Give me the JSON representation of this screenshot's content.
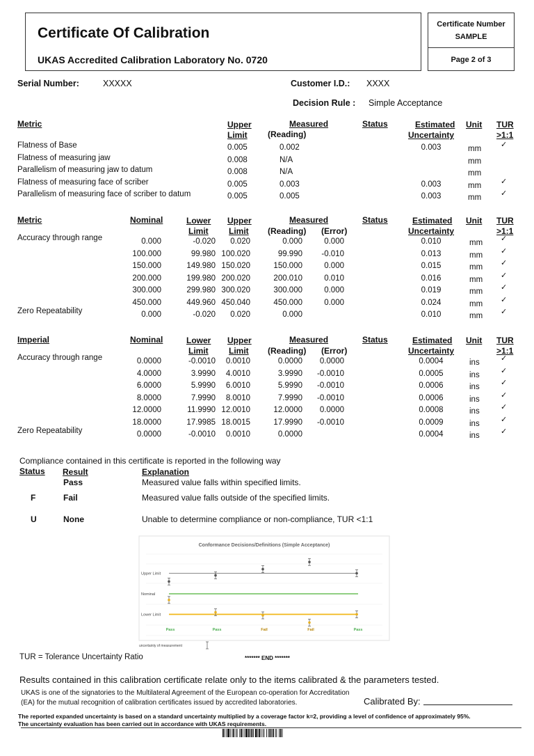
{
  "header": {
    "title": "Certificate Of Calibration",
    "subtitle": "UKAS Accredited Calibration Laboratory No. 0720",
    "cert_number_label": "Certificate Number",
    "cert_number": "SAMPLE",
    "page": "Page 2 of 3"
  },
  "info": {
    "serial_label": "Serial Number:",
    "serial_value": "XXXXX",
    "customer_label": "Customer I.D.:",
    "customer_value": "XXXX",
    "rule_label": "Decision Rule :",
    "rule_value": "Simple Acceptance"
  },
  "table1": {
    "headers": {
      "metric": "Metric",
      "upper1": "Upper",
      "upper2": "Limit",
      "measured": "Measured",
      "reading": "(Reading)",
      "status": "Status",
      "est1": "Estimated",
      "est2": "Uncertainty",
      "unit": "Unit",
      "tur1": "TUR",
      "tur2": ">1:1"
    },
    "rows": [
      {
        "name": "Flatness of Base",
        "upper": "0.005",
        "reading": "0.002",
        "unc": "0.003",
        "unit": "mm",
        "tur": "✓"
      },
      {
        "name": "Flatness of measuring jaw",
        "upper": "0.008",
        "reading": "N/A",
        "unc": "",
        "unit": "mm",
        "tur": ""
      },
      {
        "name": "Parallelism of measuring jaw to datum",
        "upper": "0.008",
        "reading": "N/A",
        "unc": "",
        "unit": "mm",
        "tur": ""
      },
      {
        "name": "Flatness of measuring face of scriber",
        "upper": "0.005",
        "reading": "0.003",
        "unc": "0.003",
        "unit": "mm",
        "tur": "✓"
      },
      {
        "name": "Parallelism of measuring face of scriber to datum",
        "upper": "0.005",
        "reading": "0.005",
        "unc": "0.003",
        "unit": "mm",
        "tur": "✓"
      }
    ]
  },
  "table2": {
    "headers": {
      "metric": "Metric",
      "nominal": "Nominal",
      "lower1": "Lower",
      "lower2": "Limit",
      "upper1": "Upper",
      "upper2": "Limit",
      "measured": "Measured",
      "reading": "(Reading)",
      "error": "(Error)",
      "status": "Status",
      "est1": "Estimated",
      "est2": "Uncertainty",
      "unit": "Unit",
      "tur1": "TUR",
      "tur2": ">1:1"
    },
    "rows": [
      {
        "name": "Accuracy through range",
        "nominal": "0.000",
        "lower": "-0.020",
        "upper": "0.020",
        "reading": "0.000",
        "error": "0.000",
        "unc": "0.010",
        "unit": "mm",
        "tur": "✓"
      },
      {
        "name": "",
        "nominal": "100.000",
        "lower": "99.980",
        "upper": "100.020",
        "reading": "99.990",
        "error": "-0.010",
        "unc": "0.013",
        "unit": "mm",
        "tur": "✓"
      },
      {
        "name": "",
        "nominal": "150.000",
        "lower": "149.980",
        "upper": "150.020",
        "reading": "150.000",
        "error": "0.000",
        "unc": "0.015",
        "unit": "mm",
        "tur": "✓"
      },
      {
        "name": "",
        "nominal": "200.000",
        "lower": "199.980",
        "upper": "200.020",
        "reading": "200.010",
        "error": "0.010",
        "unc": "0.016",
        "unit": "mm",
        "tur": "✓"
      },
      {
        "name": "",
        "nominal": "300.000",
        "lower": "299.980",
        "upper": "300.020",
        "reading": "300.000",
        "error": "0.000",
        "unc": "0.019",
        "unit": "mm",
        "tur": "✓"
      },
      {
        "name": "",
        "nominal": "450.000",
        "lower": "449.960",
        "upper": "450.040",
        "reading": "450.000",
        "error": "0.000",
        "unc": "0.024",
        "unit": "mm",
        "tur": "✓"
      },
      {
        "name": "Zero Repeatability",
        "nominal": "0.000",
        "lower": "-0.020",
        "upper": "0.020",
        "reading": "0.000",
        "error": "",
        "unc": "0.010",
        "unit": "mm",
        "tur": "✓"
      }
    ]
  },
  "table3": {
    "headers": {
      "metric": "Imperial",
      "nominal": "Nominal",
      "lower1": "Lower",
      "lower2": "Limit",
      "upper1": "Upper",
      "upper2": "Limit",
      "measured": "Measured",
      "reading": "(Reading)",
      "error": "(Error)",
      "status": "Status",
      "est1": "Estimated",
      "est2": "Uncertainty",
      "unit": "Unit",
      "tur1": "TUR",
      "tur2": ">1:1"
    },
    "rows": [
      {
        "name": "Accuracy through range",
        "nominal": "0.0000",
        "lower": "-0.0010",
        "upper": "0.0010",
        "reading": "0.0000",
        "error": "0.0000",
        "unc": "0.0004",
        "unit": "ins",
        "tur": "✓"
      },
      {
        "name": "",
        "nominal": "4.0000",
        "lower": "3.9990",
        "upper": "4.0010",
        "reading": "3.9990",
        "error": "-0.0010",
        "unc": "0.0005",
        "unit": "ins",
        "tur": "✓"
      },
      {
        "name": "",
        "nominal": "6.0000",
        "lower": "5.9990",
        "upper": "6.0010",
        "reading": "5.9990",
        "error": "-0.0010",
        "unc": "0.0006",
        "unit": "ins",
        "tur": "✓"
      },
      {
        "name": "",
        "nominal": "8.0000",
        "lower": "7.9990",
        "upper": "8.0010",
        "reading": "7.9990",
        "error": "-0.0010",
        "unc": "0.0006",
        "unit": "ins",
        "tur": "✓"
      },
      {
        "name": "",
        "nominal": "12.0000",
        "lower": "11.9990",
        "upper": "12.0010",
        "reading": "12.0000",
        "error": "0.0000",
        "unc": "0.0008",
        "unit": "ins",
        "tur": "✓"
      },
      {
        "name": "",
        "nominal": "18.0000",
        "lower": "17.9985",
        "upper": "18.0015",
        "reading": "17.9990",
        "error": "-0.0010",
        "unc": "0.0009",
        "unit": "ins",
        "tur": "✓"
      },
      {
        "name": "Zero Repeatability",
        "nominal": "0.0000",
        "lower": "-0.0010",
        "upper": "0.0010",
        "reading": "0.0000",
        "error": "",
        "unc": "0.0004",
        "unit": "ins",
        "tur": "✓"
      }
    ]
  },
  "compliance": {
    "intro": "Compliance contained in this certificate is reported in the following way",
    "headers": {
      "status": "Status",
      "result": "Result",
      "explanation": "Explanation"
    },
    "rows": [
      {
        "status": "",
        "result": "Pass",
        "explanation": "Measured value falls within specified limits."
      },
      {
        "status": "F",
        "result": "Fail",
        "explanation": "Measured value falls outside of the specified limits."
      },
      {
        "status": "U",
        "result": "None",
        "explanation": "Unable to determine compliance or non-compliance, TUR <1:1"
      }
    ]
  },
  "chart_data": {
    "type": "scatter",
    "title": "Conformance Decisions/Definitions (Simple Acceptance)",
    "ylabels": [
      "Upper Limit",
      "Nominal",
      "Lower Limit"
    ],
    "legend": "uncertainty of measurement",
    "colors": {
      "upper": "#8a8a8a",
      "nominal": "#6bbf59",
      "lower": "#f2b619",
      "point_dark": "#555555",
      "point_yellow": "#e8b020",
      "pass": "#4caf50",
      "fail": "#b8860b"
    },
    "groups": [
      {
        "label": "Pass",
        "points": [
          {
            "level": 0.6,
            "color": "dark"
          },
          {
            "level": -0.3,
            "color": "yellow"
          }
        ]
      },
      {
        "label": "Pass",
        "points": [
          {
            "level": 0.9,
            "color": "dark"
          },
          {
            "level": -0.9,
            "color": "yellow"
          }
        ]
      },
      {
        "label": "Fail",
        "points": [
          {
            "level": 1.2,
            "color": "dark"
          },
          {
            "level": -1.05,
            "color": "yellow"
          }
        ]
      },
      {
        "label": "Fail",
        "points": [
          {
            "level": 1.55,
            "color": "dark"
          },
          {
            "level": -1.4,
            "color": "yellow"
          }
        ]
      },
      {
        "label": "Pass",
        "points": [
          {
            "level": 1.0,
            "color": "dark"
          },
          {
            "level": -1.0,
            "color": "yellow"
          }
        ]
      }
    ]
  },
  "footer": {
    "tur_def": "TUR = Tolerance Uncertainty Ratio",
    "end": "******* END *******",
    "results": "Results contained in this calibration certificate relate only to the items calibrated & the parameters tested.",
    "ukas1": "UKAS is one of the signatories to the Multilateral Agreement of the European co-operation for Accreditation",
    "ukas2": "(EA) for the mutual recognition of calibration certificates issued by accredited laboratories.",
    "calibrated_by": "Calibrated By:",
    "note1": "The reported expanded uncertainty is based on a standard uncertainty multiplied by a coverage factor k=2, providing a level  of confidence of approximately 95%.",
    "note2": "The uncertainty evaluation has been carried out in accordance with UKAS requirements."
  }
}
